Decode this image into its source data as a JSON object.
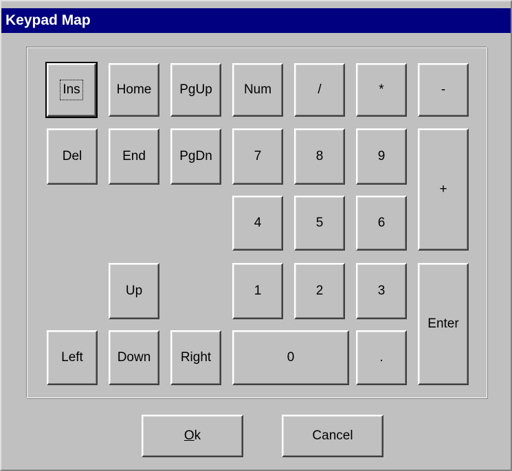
{
  "window": {
    "title": "Keypad Map"
  },
  "keys": {
    "ins": "Ins",
    "home": "Home",
    "pgup": "PgUp",
    "num": "Num",
    "divide": "/",
    "multiply": "*",
    "minus": "-",
    "del": "Del",
    "end": "End",
    "pgdn": "PgDn",
    "seven": "7",
    "eight": "8",
    "nine": "9",
    "plus": "+",
    "four": "4",
    "five": "5",
    "six": "6",
    "up": "Up",
    "one": "1",
    "two": "2",
    "three": "3",
    "enter": "Enter",
    "left": "Left",
    "down": "Down",
    "right": "Right",
    "zero": "0",
    "decimal": "."
  },
  "buttons": {
    "ok_underline": "O",
    "ok_rest": "k",
    "cancel": "Cancel"
  }
}
